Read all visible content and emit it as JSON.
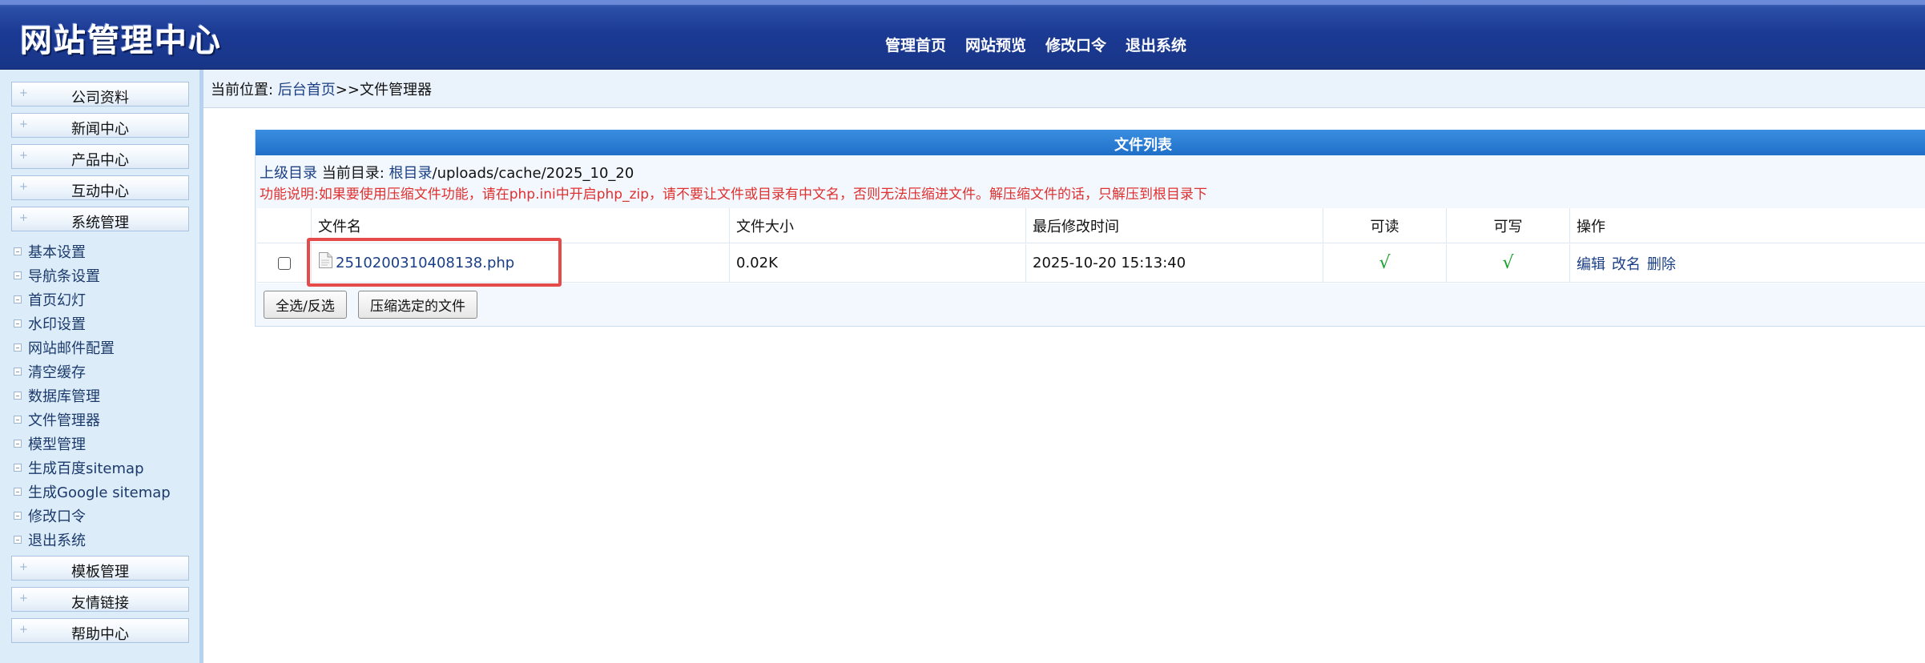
{
  "header": {
    "logo_text": "网站管理中心",
    "nav": [
      "管理首页",
      "网站预览",
      "修改口令",
      "退出系统"
    ]
  },
  "sidebar": {
    "sections_top": [
      "公司资料",
      "新闻中心",
      "产品中心",
      "互动中心",
      "系统管理"
    ],
    "system_items": [
      "基本设置",
      "导航条设置",
      "首页幻灯",
      "水印设置",
      "网站邮件配置",
      "清空缓存",
      "数据库管理",
      "文件管理器",
      "模型管理",
      "生成百度sitemap",
      "生成Google sitemap",
      "修改口令",
      "退出系统"
    ],
    "sections_bottom": [
      "模板管理",
      "友情链接",
      "帮助中心"
    ]
  },
  "breadcrumb": {
    "prefix": "当前位置: ",
    "home": "后台首页",
    "sep": ">>",
    "current": "文件管理器"
  },
  "file_panel": {
    "title": "文件列表",
    "parent_dir": "上级目录",
    "current_dir_label": " 当前目录: ",
    "root_link": "根目录",
    "path": "/uploads/cache/2025_10_20",
    "notice": "功能说明:如果要使用压缩文件功能，请在php.ini中开启php_zip，请不要让文件或目录有中文名，否则无法压缩进文件。解压缩文件的话，只解压到根目录下",
    "columns": [
      "",
      "文件名",
      "文件大小",
      "最后修改时间",
      "可读",
      "可写",
      "操作"
    ],
    "rows": [
      {
        "name": "2510200310408138.php",
        "size": "0.02K",
        "modified": "2025-10-20 15:13:40",
        "readable": "√",
        "writable": "√",
        "ops": [
          "编辑",
          "改名",
          "删除"
        ]
      }
    ],
    "buttons": {
      "select_all": "全选/反选",
      "compress": "压缩选定的文件"
    }
  },
  "colors": {
    "header_blue": "#1b3a94",
    "panel_title_blue": "#2a7fd6",
    "link_blue": "#1b3f86",
    "notice_red": "#e03030",
    "tick_green": "#16a12a",
    "highlight_red": "#e54b4b"
  },
  "icons": {
    "file": "file-icon",
    "checkbox": "checkbox-icon"
  }
}
